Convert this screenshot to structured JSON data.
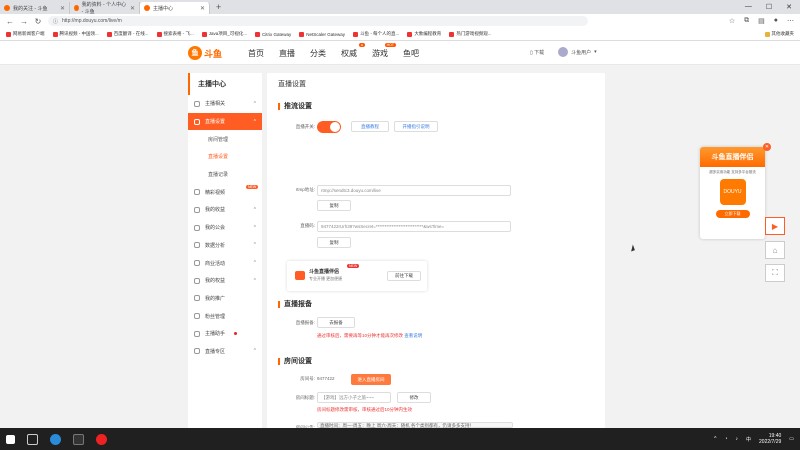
{
  "browser": {
    "tabs": [
      {
        "label": "我的关注 - 斗鱼",
        "active": false
      },
      {
        "label": "我的资料 - 个人中心 - 斗鱼",
        "active": false
      },
      {
        "label": "主播中心",
        "active": true
      }
    ],
    "new_tab": "+",
    "window_buttons": [
      "—",
      "☐",
      "✕"
    ],
    "url": "http://mp.douyu.com/live/m",
    "bookmarks": [
      "网易新闻客户端",
      "腾讯视频 - 中国领...",
      "百度翻译 - 在线...",
      "搜索表格 - 飞...",
      "Java项目_可视化...",
      "Citrix Gateway",
      "NetScaler Gateway",
      "斗鱼 - 每个人的直...",
      "大象编程教育",
      "热门游戏视频观..."
    ],
    "bookmarks_right": "其他收藏夹"
  },
  "site": {
    "logo_text": "斗鱼",
    "logo_sub": "DOUYU.COM",
    "nav": [
      {
        "label": "首页",
        "badge": ""
      },
      {
        "label": "直播",
        "badge": ""
      },
      {
        "label": "分类",
        "badge": ""
      },
      {
        "label": "权威",
        "badge": "●"
      },
      {
        "label": "游戏",
        "badge": "HOT"
      },
      {
        "label": "鱼吧",
        "badge": ""
      }
    ],
    "download": "下载",
    "username": "斗鱼用户"
  },
  "sidebar": {
    "title": "主播中心",
    "items": [
      {
        "label": "主播相关",
        "type": "item",
        "chev": "^"
      },
      {
        "label": "直播设置",
        "type": "active",
        "chev": "^"
      },
      {
        "label": "房间管理",
        "type": "sub"
      },
      {
        "label": "直播设置",
        "type": "sub-current"
      },
      {
        "label": "直播记录",
        "type": "sub"
      },
      {
        "label": "精彩视频",
        "type": "item",
        "chev": "",
        "hot": "NEW"
      },
      {
        "label": "我的收益",
        "type": "item",
        "chev": "^"
      },
      {
        "label": "我的公会",
        "type": "item",
        "chev": "^"
      },
      {
        "label": "数据分析",
        "type": "item",
        "chev": "^"
      },
      {
        "label": "商业活动",
        "type": "item",
        "chev": "^"
      },
      {
        "label": "我的权益",
        "type": "item",
        "chev": "^"
      },
      {
        "label": "我的推广",
        "type": "item",
        "chev": ""
      },
      {
        "label": "粉丝管理",
        "type": "item",
        "chev": ""
      },
      {
        "label": "主播助手",
        "type": "item",
        "chev": "",
        "dot": true
      },
      {
        "label": "直播专区",
        "type": "item",
        "chev": "^"
      }
    ]
  },
  "content": {
    "page_title": "直播设置",
    "stream": {
      "section": "推流设置",
      "switch_label": "直播开关:",
      "btn_tutorial": "直播教程",
      "btn_guide": "开播指引说明",
      "rtmp_label": "rtmp地址:",
      "rtmp_value": "rtmp://sendtc3.douyu.com/live",
      "copy": "复制",
      "code_label": "直播码:",
      "code_value": "9477422rUrh39?wsSecret=***************************&wsTime=",
      "promo_title": "斗鱼直播伴侣",
      "promo_new": "NEW",
      "promo_sub": "专业开播 更加便捷",
      "promo_btn": "前往下载"
    },
    "report": {
      "section": "直播报备",
      "label": "直播报备:",
      "btn": "去报备",
      "warn": "通过审核后，需要再等10分钟才能再次修改",
      "link": "查看说明"
    },
    "room": {
      "section": "房间设置",
      "room_label": "房间号:",
      "room_value": "9477422",
      "enter_btn": "进入直播房间",
      "title_label": "房间标题:",
      "title_value": "【游戏】远方小子之旅~~~",
      "modify": "修改",
      "warn": "房间标题修改需审核，审核通过后10分钟内生效",
      "notice_label": "房间公告:",
      "notice_value": "直播时间：周一-周五：晚上 周六-周天：随机 各个类别都有，仍请多多支持！"
    }
  },
  "floater": {
    "title": "斗鱼直播伴侣",
    "sub": "超多实用功能 支持多平台推流",
    "app": "DOUYU",
    "download": "立即下载",
    "close": "✕"
  },
  "float_buttons": [
    "▶",
    "⌂",
    "⛶"
  ],
  "taskbar": {
    "time": "19:40",
    "date": "2022/7/29",
    "lang": "中"
  }
}
